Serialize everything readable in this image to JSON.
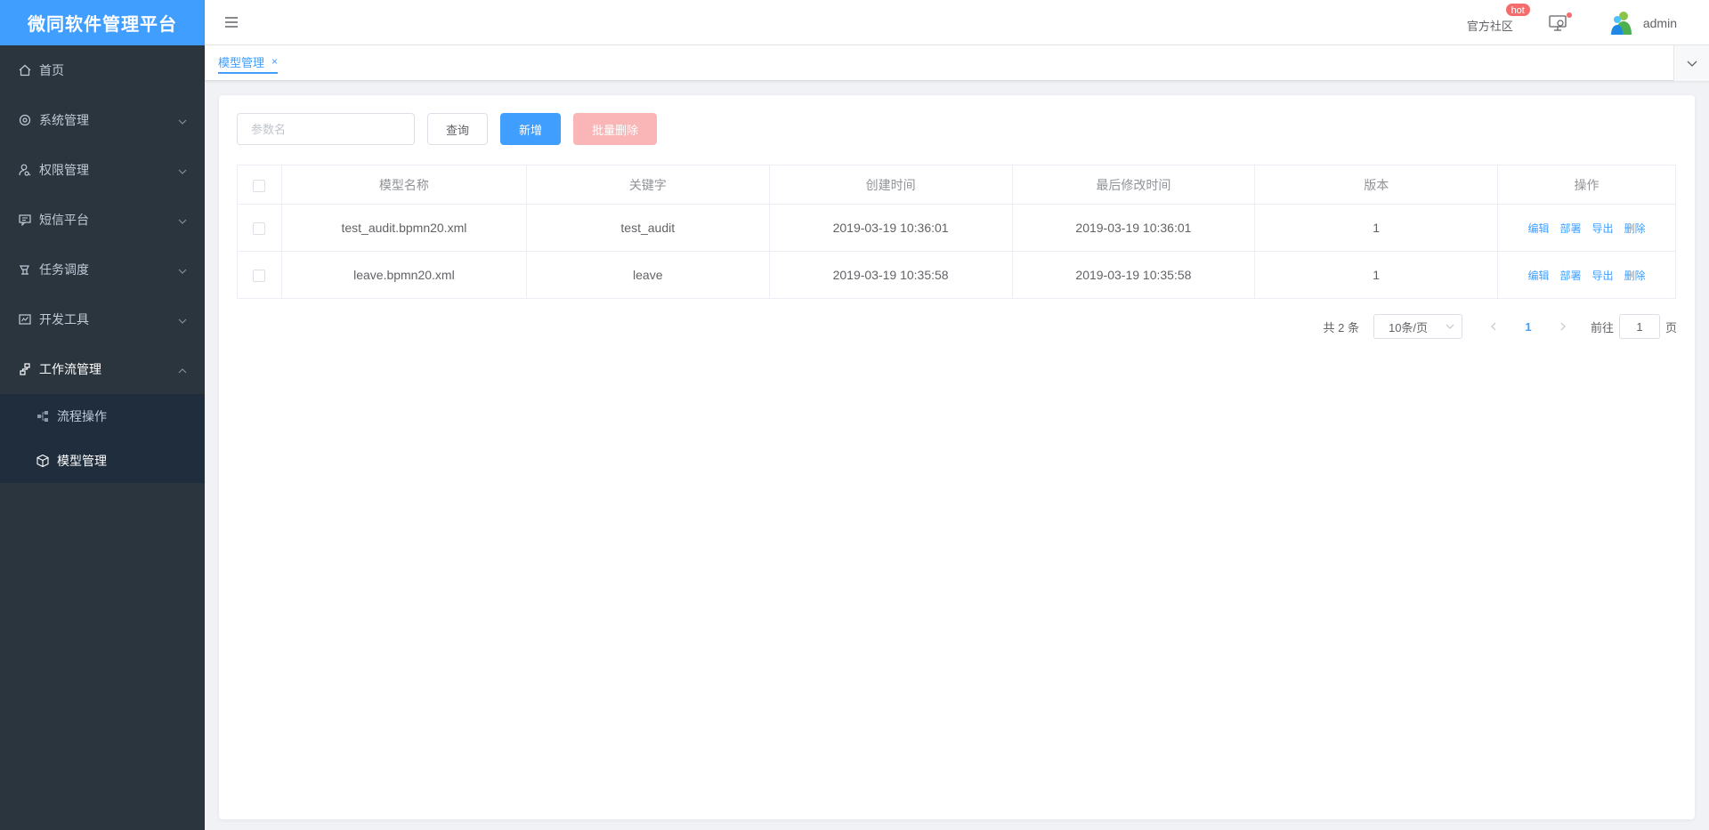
{
  "brand": {
    "title": "微同软件管理平台",
    "color": "#409eff"
  },
  "sidebar": {
    "items": [
      {
        "label": "首页",
        "icon": "home-icon"
      },
      {
        "label": "系统管理",
        "icon": "gear-icon"
      },
      {
        "label": "权限管理",
        "icon": "permission-icon"
      },
      {
        "label": "短信平台",
        "icon": "message-icon"
      },
      {
        "label": "任务调度",
        "icon": "schedule-icon"
      },
      {
        "label": "开发工具",
        "icon": "dev-tools-icon"
      },
      {
        "label": "工作流管理",
        "icon": "workflow-icon"
      }
    ],
    "submenu": [
      {
        "label": "流程操作",
        "icon": "process-icon"
      },
      {
        "label": "模型管理",
        "icon": "cube-icon"
      }
    ]
  },
  "header": {
    "community": "官方社区",
    "hot_badge": "hot",
    "user_name": "admin"
  },
  "tags": {
    "active_tag": "模型管理",
    "close": "×"
  },
  "toolbar": {
    "search_placeholder": "参数名",
    "query_label": "查询",
    "add_label": "新增",
    "batch_delete_label": "批量删除"
  },
  "table": {
    "headers": [
      "模型名称",
      "关键字",
      "创建时间",
      "最后修改时间",
      "版本",
      "操作"
    ],
    "rows": [
      {
        "name": "test_audit.bpmn20.xml",
        "key": "test_audit",
        "created": "2019-03-19 10:36:01",
        "modified": "2019-03-19 10:36:01",
        "version": "1"
      },
      {
        "name": "leave.bpmn20.xml",
        "key": "leave",
        "created": "2019-03-19 10:35:58",
        "modified": "2019-03-19 10:35:58",
        "version": "1"
      }
    ],
    "ops": {
      "edit": "编辑",
      "deploy": "部署",
      "export": "导出",
      "delete": "删除"
    }
  },
  "pagination": {
    "total": "共 2 条",
    "page_size": "10条/页",
    "current_page": "1",
    "goto_prefix": "前往",
    "goto_value": "1",
    "goto_suffix": "页"
  }
}
